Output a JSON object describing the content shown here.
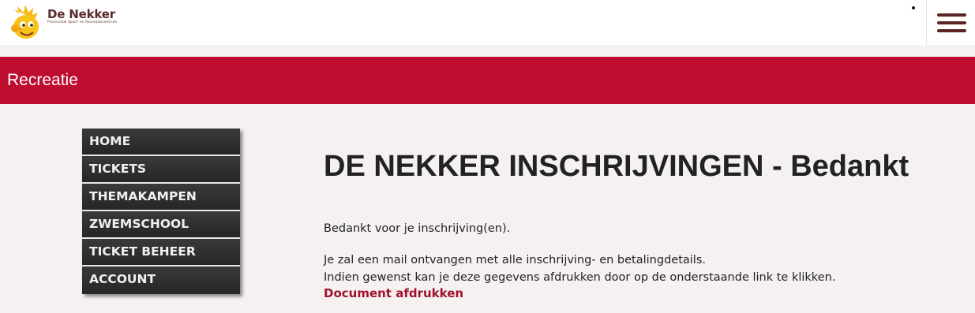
{
  "brand": {
    "name": "De Nekker",
    "subtitle": "Provinciaal Sport- en Recreatiecentrum"
  },
  "header": {
    "menu_icon": "hamburger-menu-icon"
  },
  "banner": {
    "title": "Recreatie"
  },
  "sidebar": {
    "items": [
      {
        "label": "HOME"
      },
      {
        "label": "TICKETS"
      },
      {
        "label": "THEMAKAMPEN"
      },
      {
        "label": "ZWEMSCHOOL"
      },
      {
        "label": "TICKET BEHEER"
      },
      {
        "label": "ACCOUNT"
      }
    ]
  },
  "main": {
    "title": "DE NEKKER INSCHRIJVINGEN - Bedankt",
    "thanks_text": "Bedankt voor je inschrijving(en).",
    "mail_text": "Je zal een mail ontvangen met alle inschrijving- en betalingdetails.",
    "print_text": "Indien gewenst kan je deze gegevens afdrukken door op de onderstaande link te klikken.",
    "print_link": "Document afdrukken"
  },
  "colors": {
    "banner": "#be0c2f",
    "nav_background": "#2e2e2e",
    "link": "#a0112b",
    "brand_text": "#5a2a2a"
  }
}
